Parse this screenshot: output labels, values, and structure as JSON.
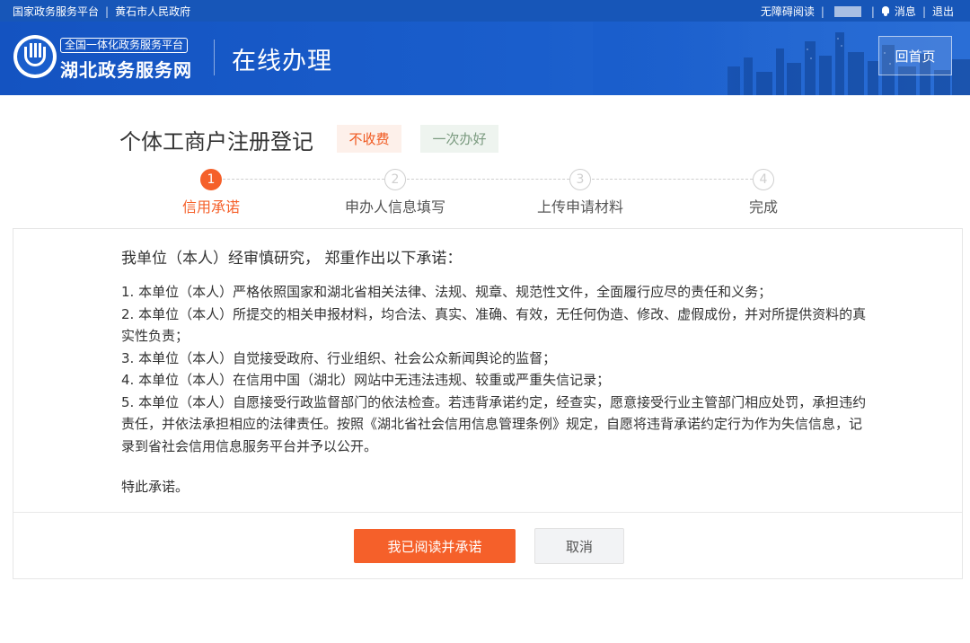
{
  "topbar": {
    "left_links": [
      "国家政务服务平台",
      "黄石市人民政府"
    ],
    "accessibility": "无障碍阅读",
    "messages": "消息",
    "logout": "退出"
  },
  "header": {
    "brand_small": "全国一体化政务服务平台",
    "brand_big": "湖北政务服务网",
    "section": "在线办理",
    "home_button": "回首页"
  },
  "page": {
    "title": "个体工商户注册登记",
    "tags": [
      "不收费",
      "一次办好"
    ]
  },
  "steps": [
    {
      "number": "1",
      "label": "信用承诺",
      "active": true
    },
    {
      "number": "2",
      "label": "申办人信息填写",
      "active": false
    },
    {
      "number": "3",
      "label": "上传申请材料",
      "active": false
    },
    {
      "number": "4",
      "label": "完成",
      "active": false
    }
  ],
  "pledge": {
    "heading": "我单位（本人）经审慎研究， 郑重作出以下承诺：",
    "items": [
      "1. 本单位（本人）严格依照国家和湖北省相关法律、法规、规章、规范性文件，全面履行应尽的责任和义务；",
      "2. 本单位（本人）所提交的相关申报材料，均合法、真实、准确、有效，无任何伪造、修改、虚假成份，并对所提供资料的真实性负责；",
      "3. 本单位（本人）自觉接受政府、行业组织、社会公众新闻舆论的监督；",
      "4. 本单位（本人）在信用中国（湖北）网站中无违法违规、较重或严重失信记录；",
      "5. 本单位（本人）自愿接受行政监督部门的依法检查。若违背承诺约定，经查实，愿意接受行业主管部门相应处罚，承担违约责任，并依法承担相应的法律责任。按照《湖北省社会信用信息管理条例》规定，自愿将违背承诺约定行为作为失信信息，记录到省社会信用信息服务平台并予以公开。"
    ],
    "closing": "特此承诺。"
  },
  "actions": {
    "agree": "我已阅读并承诺",
    "cancel": "取消"
  },
  "colors": {
    "primary_blue": "#1756b8",
    "accent_orange": "#f5602a"
  }
}
